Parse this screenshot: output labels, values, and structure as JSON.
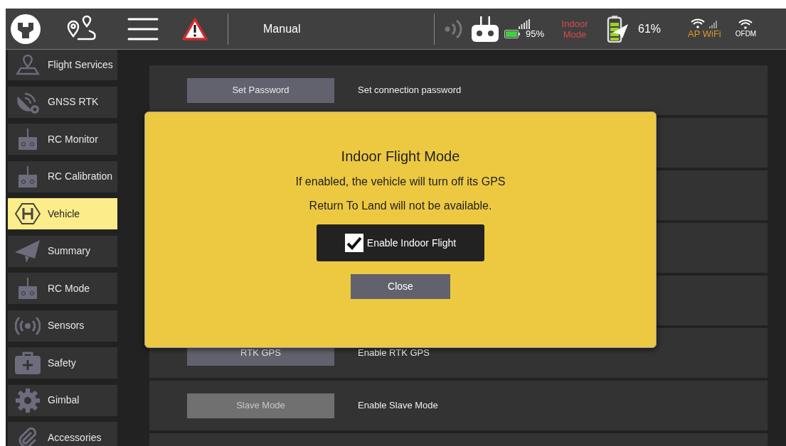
{
  "toolbar": {
    "flight_mode": "Manual",
    "rc_battery": "95%",
    "indoor_mode": "Indoor Mode",
    "vehicle_battery": "61%",
    "wifi_label": "AP WiFi",
    "link_label": "OFDM"
  },
  "sidebar": {
    "items": [
      {
        "label": "Flight Services",
        "kind": "map",
        "selected": false
      },
      {
        "label": "GNSS RTK",
        "kind": "satellite",
        "selected": false
      },
      {
        "label": "RC Monitor",
        "kind": "remote",
        "selected": false
      },
      {
        "label": "RC Calibration",
        "kind": "remote",
        "selected": false
      },
      {
        "label": "Vehicle",
        "kind": "helipad",
        "selected": true
      },
      {
        "label": "Summary",
        "kind": "plane",
        "selected": false
      },
      {
        "label": "RC Mode",
        "kind": "remote",
        "selected": false
      },
      {
        "label": "Sensors",
        "kind": "sensor",
        "selected": false
      },
      {
        "label": "Safety",
        "kind": "medkit",
        "selected": false
      },
      {
        "label": "Gimbal",
        "kind": "gear",
        "selected": false
      },
      {
        "label": "Accessories",
        "kind": "clip",
        "selected": false
      }
    ]
  },
  "settings": {
    "rows": [
      {
        "kind": "visible",
        "button": "Set Password",
        "description": "Set connection password",
        "disabled": false
      },
      {
        "kind": "covered"
      },
      {
        "kind": "covered"
      },
      {
        "kind": "covered"
      },
      {
        "kind": "covered"
      },
      {
        "kind": "visible",
        "button": "RTK GPS",
        "description": "Enable RTK GPS",
        "disabled": false
      },
      {
        "kind": "visible",
        "button": "Slave Mode",
        "description": "Enable Slave Mode",
        "disabled": true
      },
      {
        "kind": "covered"
      }
    ]
  },
  "dialog": {
    "title": "Indoor Flight Mode",
    "lines": [
      "If enabled, the vehicle will turn off its GPS",
      "Return To Land will not be available."
    ],
    "checkbox": {
      "label": "Enable Indoor Flight",
      "checked": true
    },
    "close_button": "Close"
  }
}
